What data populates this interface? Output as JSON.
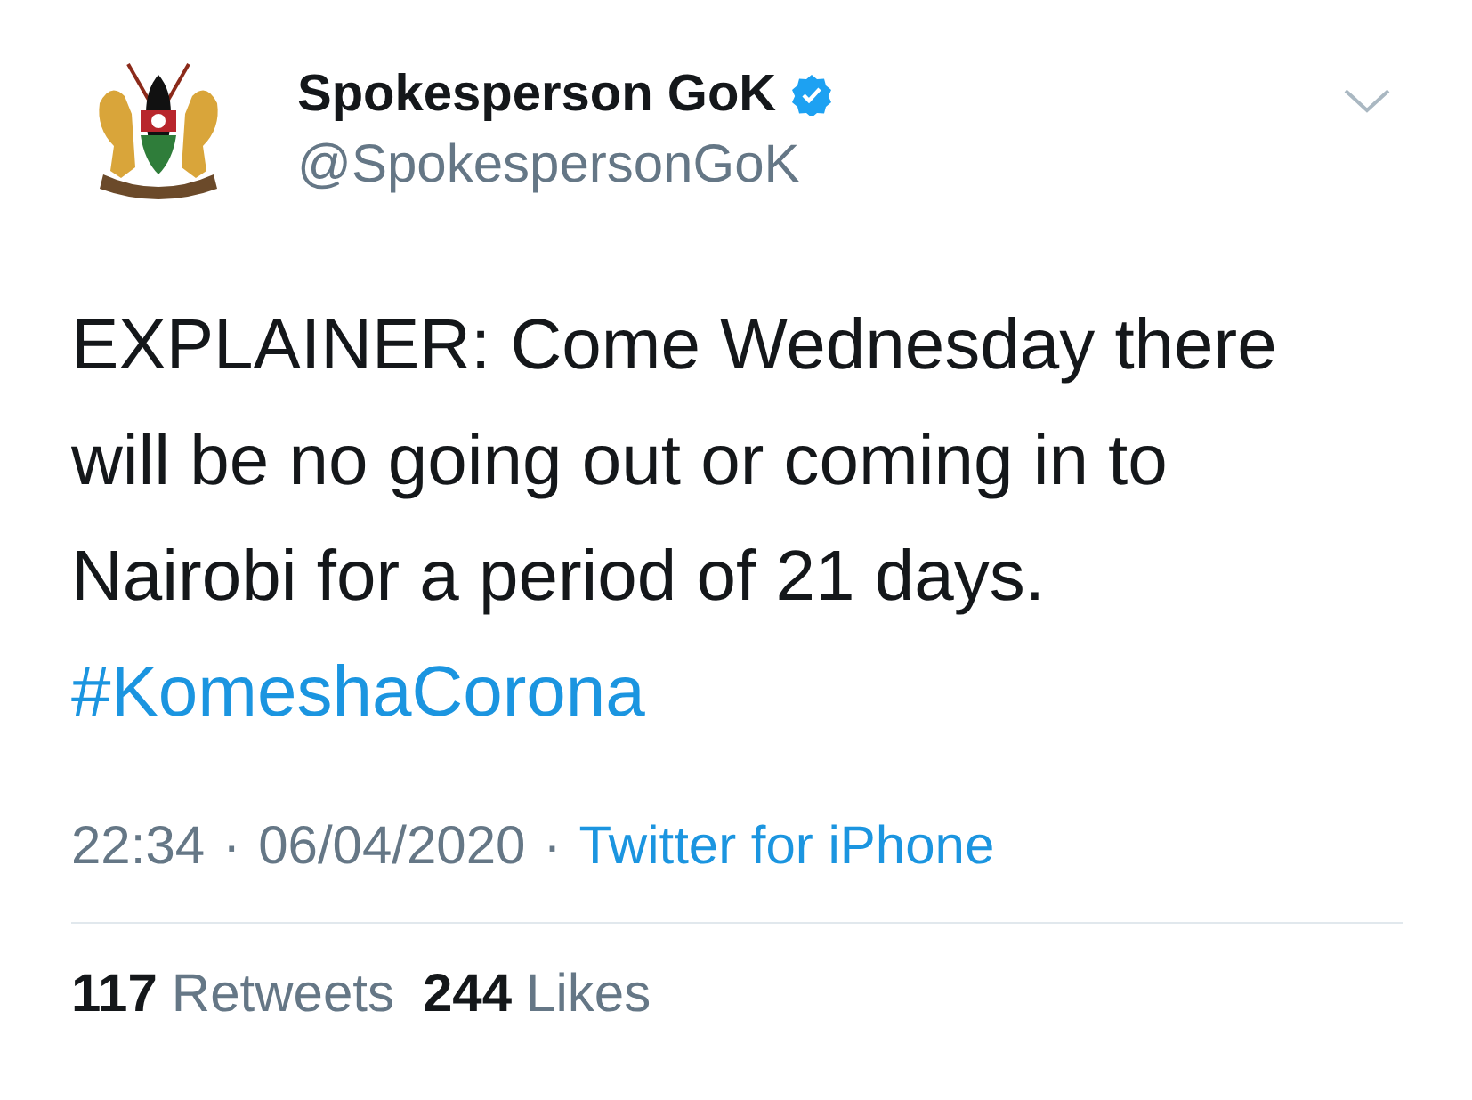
{
  "tweet": {
    "author": {
      "name": "Spokesperson GoK",
      "verified": true,
      "handle": "@SpokespersonGoK"
    },
    "text": "EXPLAINER: Come Wednesday there will be no going out or coming in to Nairobi for a period of 21 days.",
    "hashtag": "#KomeshaCorona",
    "meta": [
      {
        "kind": "plain",
        "text": "22:34"
      },
      {
        "kind": "separator",
        "text": "·"
      },
      {
        "kind": "plain",
        "text": "06/04/2020"
      },
      {
        "kind": "separator",
        "text": "·"
      },
      {
        "kind": "link",
        "text": "Twitter for iPhone"
      }
    ],
    "stats": [
      {
        "count": "117",
        "label": "Retweets"
      },
      {
        "count": "244",
        "label": "Likes"
      }
    ]
  }
}
